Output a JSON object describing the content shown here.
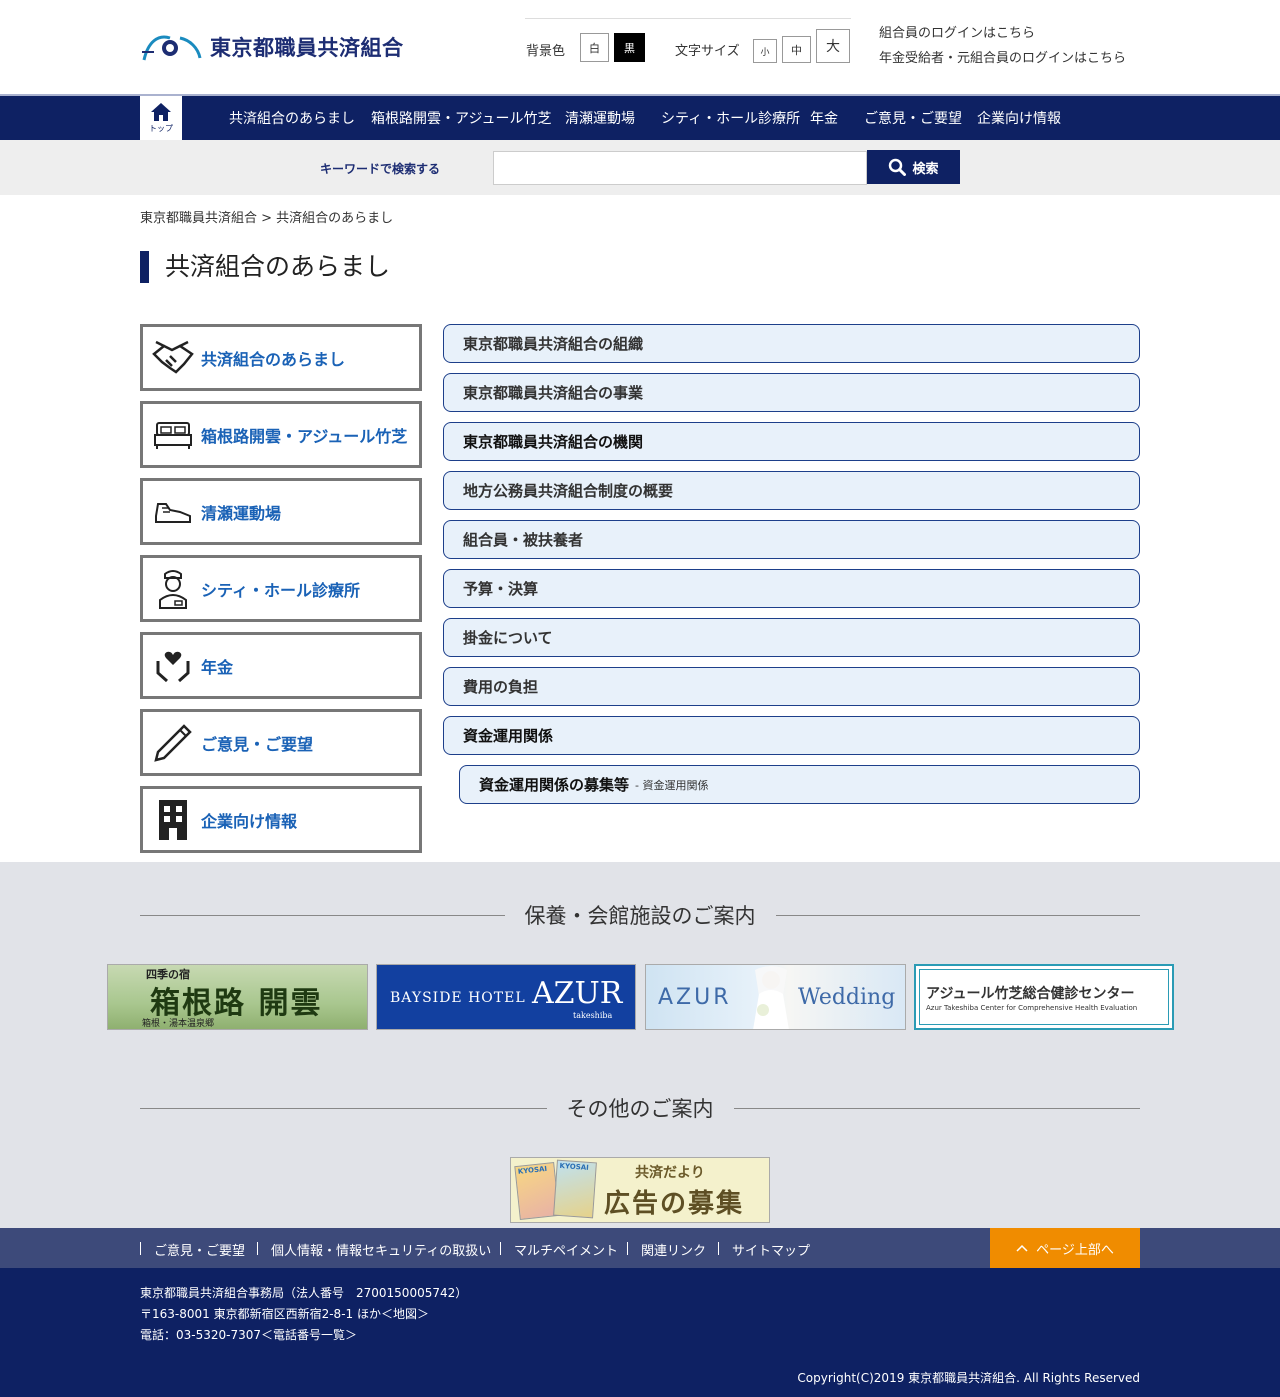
{
  "header": {
    "logo_text": "東京都職員共済組合",
    "bg_color_label": "背景色",
    "bg_white": "白",
    "bg_black": "黒",
    "font_size_label": "文字サイズ",
    "font_small": "小",
    "font_medium": "中",
    "font_large": "大",
    "login_member": "組合員のログインはこちら",
    "login_pension": "年金受給者・元組合員のログインはこちら"
  },
  "nav": {
    "home_label": "トップ",
    "items": [
      "共済組合のあらまし",
      "箱根路開雲・アジュール竹芝",
      "清瀬運動場",
      "シティ・ホール診療所",
      "年金",
      "ご意見・ご要望",
      "企業向け情報"
    ]
  },
  "search": {
    "label": "キーワードで検索する",
    "placeholder": "",
    "button_label": "検索"
  },
  "breadcrumb": "東京都職員共済組合 > 共済組合のあらまし",
  "page_title": "共済組合のあらまし",
  "side_menu": [
    {
      "label": "共済組合のあらまし",
      "icon": "handshake-icon"
    },
    {
      "label": "箱根路開雲・アジュール竹芝",
      "icon": "bed-icon"
    },
    {
      "label": "清瀬運動場",
      "icon": "sneaker-icon"
    },
    {
      "label": "シティ・ホール診療所",
      "icon": "nurse-icon"
    },
    {
      "label": "年金",
      "icon": "heart-hands-icon"
    },
    {
      "label": "ご意見・ご要望",
      "icon": "pencil-icon"
    },
    {
      "label": "企業向け情報",
      "icon": "building-icon"
    }
  ],
  "content_list": [
    "東京都職員共済組合の組織",
    "東京都職員共済組合の事業",
    "東京都職員共済組合の機関",
    "地方公務員共済組合制度の概要",
    "組合員・被扶養者",
    "予算・決算",
    "掛金について",
    "費用の負担",
    "資金運用関係"
  ],
  "content_sub_item": {
    "label": "資金運用関係の募集等",
    "tag": "- 資金運用関係"
  },
  "facilities": {
    "heading": "保養・会館施設のご案内",
    "banners": [
      {
        "top": "四季の宿",
        "main": "箱根路 開雲",
        "bottom": "箱根・湯本温泉郷"
      },
      {
        "main": "BAYSIDE HOTEL",
        "brand": "AZUR",
        "sub": "takeshiba"
      },
      {
        "main": "AZUR",
        "sub": "Wedding"
      },
      {
        "main": "アジュール竹芝総合健診センター",
        "sub": "Azur Takeshiba Center for Comprehensive Health Evaluation"
      }
    ]
  },
  "others": {
    "heading": "その他のご案内",
    "ad_title": "共済だより",
    "ad_main": "広告の募集",
    "ad_mag": "KYOSAI"
  },
  "footer_nav": {
    "links": [
      "ご意見・ご要望",
      "個人情報・情報セキュリティの取扱い",
      "マルチペイメント",
      "関連リンク",
      "サイトマップ"
    ],
    "page_top": "ページ上部へ"
  },
  "footer": {
    "line1": "東京都職員共済組合事務局（法人番号　2700150005742）",
    "line2": "〒163-8001 東京都新宿区西新宿2-8-1 ほか＜地図＞",
    "line3": "電話：03-5320-7307＜電話番号一覧＞",
    "copyright": "Copyright(C)2019 東京都職員共済組合. All Rights Reserved"
  },
  "colors": {
    "navy": "#0e2163",
    "link_blue": "#1a62b6",
    "list_bg": "#e8f1fa",
    "orange": "#f08c00"
  }
}
